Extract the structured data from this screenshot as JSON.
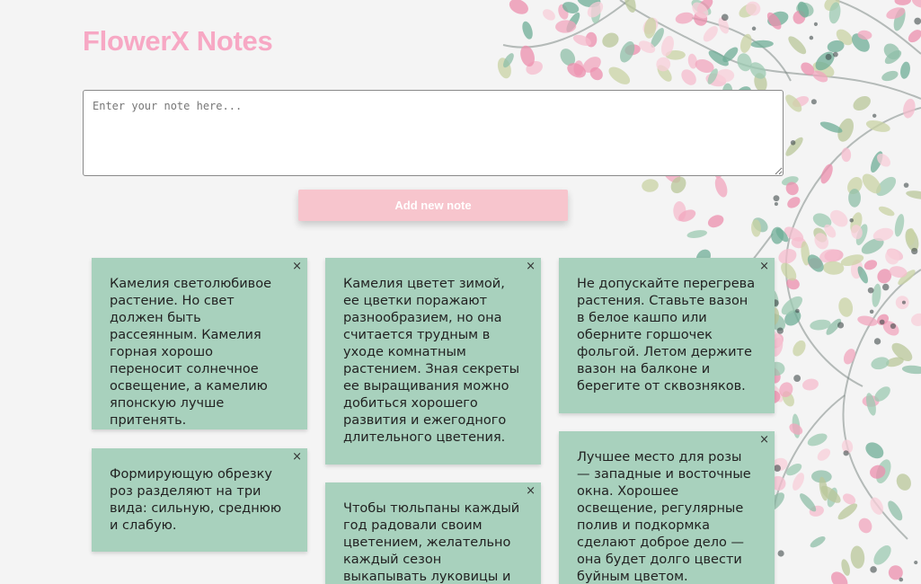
{
  "app": {
    "title": "FlowerX Notes"
  },
  "colors": {
    "title": "#f7a8c4",
    "button_bg": "#f7c5cd",
    "note_bg": "#a8d1bd",
    "background": "#f4f4f4"
  },
  "editor": {
    "placeholder": "Enter your note here...",
    "value": ""
  },
  "add_button": {
    "label": "Add new note"
  },
  "notes": [
    {
      "text": "Камелия светолюбивое растение. Но свет должен быть рассеянным. Камелия горная хорошо переносит солнечное освещение, а камелию японскую лучше притенять.",
      "close": "×"
    },
    {
      "text": "Камелия цветет зимой, ее цветки поражают разнообразием, но она считается трудным в уходе комнатным растением. Зная секреты ее выращивания можно добиться хорошего развития и ежегодного длительного цветения.",
      "close": "×"
    },
    {
      "text": "Не допускайте перегрева растения. Ставьте вазон в белое кашпо или оберните горшочек фольгой. Летом держите вазон на балконе и берегите от сквозняков.",
      "close": "×"
    },
    {
      "text": "Формирующую обрезку роз разделяют на три вида: сильную, среднюю и слабую.",
      "close": "×"
    },
    {
      "text": "Чтобы тюльпаны каждый год радовали своим цветением, желательно каждый сезон выкапывать луковицы и",
      "close": "×"
    },
    {
      "text": "Лучшее место для розы — западные и восточные окна. Хорошее освещение, регулярные полив и подкормка сделают доброе дело — она будет долго цвести буйным цветом.",
      "close": "×"
    }
  ]
}
